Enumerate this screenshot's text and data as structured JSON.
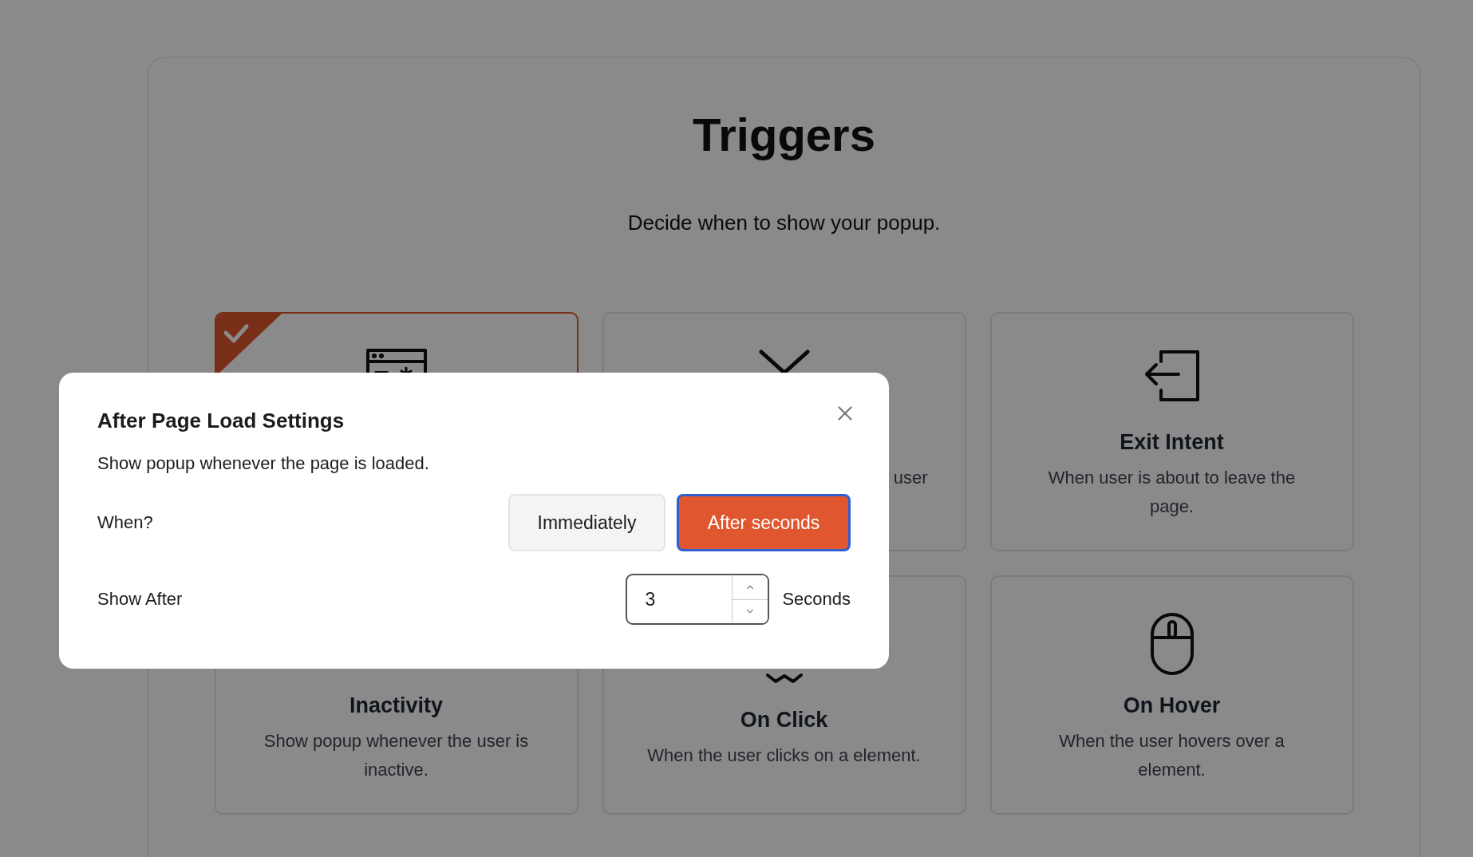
{
  "page": {
    "title": "Triggers",
    "subtitle": "Decide when to show your popup."
  },
  "cards": [
    {
      "kind": "page-load",
      "selected": true
    },
    {
      "kind": "scroll",
      "selected": false,
      "description": "user"
    },
    {
      "kind": "exit",
      "selected": false,
      "title": "Exit Intent",
      "description": "When user is about to leave the page."
    },
    {
      "kind": "inactivity",
      "selected": false,
      "title": "Inactivity",
      "description": "Show popup whenever the user is inactive."
    },
    {
      "kind": "click",
      "selected": false,
      "title": "On Click",
      "description": "When the user clicks on a element."
    },
    {
      "kind": "hover",
      "selected": false,
      "title": "On Hover",
      "description": "When the user hovers over a element."
    }
  ],
  "dialog": {
    "title": "After Page Load Settings",
    "description": "Show popup whenever the page is loaded.",
    "when_label": "When?",
    "when_options": [
      {
        "label": "Immediately",
        "selected": false
      },
      {
        "label": "After seconds",
        "selected": true
      }
    ],
    "show_after_label": "Show After",
    "show_after_value": "3",
    "unit": "Seconds"
  }
}
